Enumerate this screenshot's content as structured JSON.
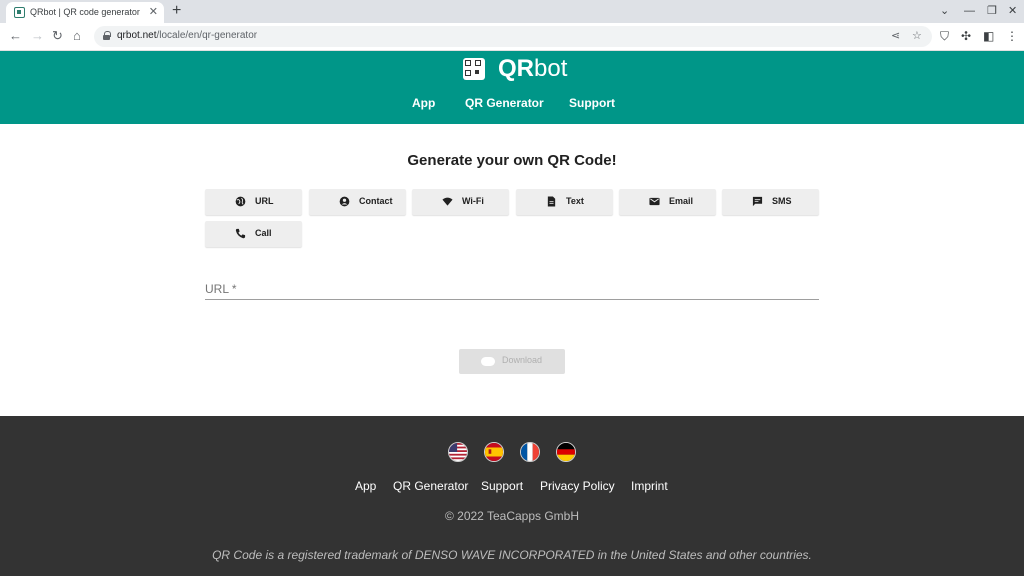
{
  "browser": {
    "tab_title": "QRbot | QR code generator",
    "tab_close": "✕",
    "new_tab": "+",
    "url_domain": "qrbot.net",
    "url_path": "/locale/en/qr-generator"
  },
  "header": {
    "logo_bold": "QR",
    "logo_rest": "bot",
    "nav": [
      "App",
      "QR Generator",
      "Support"
    ]
  },
  "main": {
    "title": "Generate your own QR Code!",
    "types": [
      {
        "label": "URL",
        "icon": "globe-icon"
      },
      {
        "label": "Contact",
        "icon": "person-icon"
      },
      {
        "label": "Wi-Fi",
        "icon": "wifi-icon"
      },
      {
        "label": "Text",
        "icon": "document-icon"
      },
      {
        "label": "Email",
        "icon": "envelope-icon"
      },
      {
        "label": "SMS",
        "icon": "chat-icon"
      },
      {
        "label": "Call",
        "icon": "phone-icon"
      }
    ],
    "field_label": "URL *",
    "download_label": "Download"
  },
  "footer": {
    "flags": [
      "us-flag-icon",
      "spain-flag-icon",
      "france-flag-icon",
      "germany-flag-icon"
    ],
    "links": [
      "App",
      "QR Generator",
      "Support",
      "Privacy Policy",
      "Imprint"
    ],
    "copyright": "© 2022 TeaCapps GmbH",
    "trademark": "QR Code is a registered trademark of DENSO WAVE INCORPORATED in the United States and other countries."
  },
  "colors": {
    "header_bg": "#009688",
    "footer_bg": "#333333",
    "button_bg": "#eeeeee"
  }
}
